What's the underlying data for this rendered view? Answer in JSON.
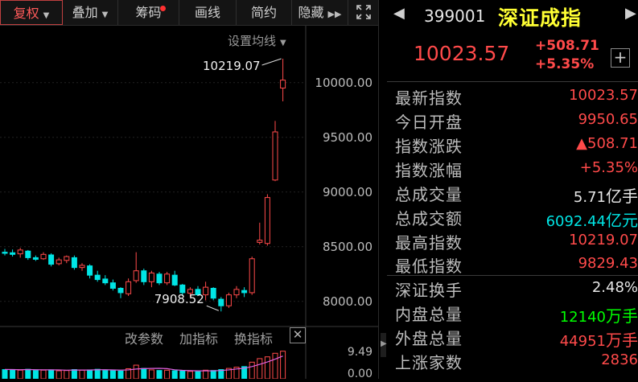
{
  "toolbar": {
    "items": [
      {
        "label": "复权",
        "has_dropdown": true,
        "active": true
      },
      {
        "label": "叠加",
        "has_dropdown": true
      },
      {
        "label": "筹码",
        "has_dot": true
      },
      {
        "label": "画线"
      },
      {
        "label": "简约"
      },
      {
        "label": "隐藏",
        "has_more": true
      }
    ],
    "expand_icon": "fullscreen-icon"
  },
  "chart": {
    "ma_setting_label": "设置均线",
    "price_axis": [
      "10000.00",
      "9500.00",
      "9000.00",
      "8500.00",
      "8000.00"
    ],
    "high_annotation": "10219.07",
    "low_annotation": "7908.52",
    "bottom_links": [
      "改参数",
      "加指标",
      "换指标"
    ],
    "close_icon": "close-icon",
    "volume_axis": [
      "9.49",
      "0.00"
    ],
    "colors": {
      "up": "#ff4a4a",
      "down": "#00e5e5",
      "ma": "#e060e0"
    }
  },
  "chart_data": {
    "type": "candlestick",
    "ylim": [
      7800,
      10300
    ],
    "candles": [
      {
        "o": 8450,
        "h": 8480,
        "l": 8420,
        "c": 8440
      },
      {
        "o": 8445,
        "h": 8475,
        "l": 8410,
        "c": 8430
      },
      {
        "o": 8435,
        "h": 8490,
        "l": 8400,
        "c": 8470
      },
      {
        "o": 8460,
        "h": 8470,
        "l": 8380,
        "c": 8400
      },
      {
        "o": 8400,
        "h": 8420,
        "l": 8370,
        "c": 8385
      },
      {
        "o": 8390,
        "h": 8450,
        "l": 8380,
        "c": 8430
      },
      {
        "o": 8425,
        "h": 8440,
        "l": 8320,
        "c": 8340
      },
      {
        "o": 8345,
        "h": 8400,
        "l": 8330,
        "c": 8380
      },
      {
        "o": 8375,
        "h": 8420,
        "l": 8350,
        "c": 8410
      },
      {
        "o": 8400,
        "h": 8420,
        "l": 8290,
        "c": 8310
      },
      {
        "o": 8310,
        "h": 8350,
        "l": 8280,
        "c": 8330
      },
      {
        "o": 8325,
        "h": 8340,
        "l": 8210,
        "c": 8240
      },
      {
        "o": 8240,
        "h": 8280,
        "l": 8180,
        "c": 8200
      },
      {
        "o": 8205,
        "h": 8240,
        "l": 8150,
        "c": 8170
      },
      {
        "o": 8170,
        "h": 8200,
        "l": 8100,
        "c": 8120
      },
      {
        "o": 8120,
        "h": 8130,
        "l": 8030,
        "c": 8080
      },
      {
        "o": 8070,
        "h": 8210,
        "l": 8050,
        "c": 8180
      },
      {
        "o": 8190,
        "h": 8450,
        "l": 8170,
        "c": 8280
      },
      {
        "o": 8280,
        "h": 8300,
        "l": 8150,
        "c": 8180
      },
      {
        "o": 8180,
        "h": 8280,
        "l": 8130,
        "c": 8260
      },
      {
        "o": 8250,
        "h": 8270,
        "l": 8150,
        "c": 8170
      },
      {
        "o": 8170,
        "h": 8270,
        "l": 8150,
        "c": 8250
      },
      {
        "o": 8240,
        "h": 8280,
        "l": 8140,
        "c": 8150
      },
      {
        "o": 8150,
        "h": 8160,
        "l": 8050,
        "c": 8080
      },
      {
        "o": 8075,
        "h": 8130,
        "l": 8040,
        "c": 8110
      },
      {
        "o": 8110,
        "h": 8140,
        "l": 8050,
        "c": 8060
      },
      {
        "o": 8060,
        "h": 8180,
        "l": 8010,
        "c": 8130
      },
      {
        "o": 8120,
        "h": 8130,
        "l": 8010,
        "c": 8030
      },
      {
        "o": 8020,
        "h": 8040,
        "l": 7908.52,
        "c": 7960
      },
      {
        "o": 7960,
        "h": 8080,
        "l": 7940,
        "c": 8060
      },
      {
        "o": 8060,
        "h": 8140,
        "l": 8030,
        "c": 8110
      },
      {
        "o": 8100,
        "h": 8130,
        "l": 8040,
        "c": 8080
      },
      {
        "o": 8080,
        "h": 8410,
        "l": 8060,
        "c": 8390
      },
      {
        "o": 8540,
        "h": 8720,
        "l": 8520,
        "c": 8560
      },
      {
        "o": 8530,
        "h": 8980,
        "l": 8510,
        "c": 8950
      },
      {
        "o": 9110,
        "h": 9650,
        "l": 9100,
        "c": 9550
      },
      {
        "o": 9950.65,
        "h": 10219.07,
        "l": 9829.43,
        "c": 10023.57
      }
    ],
    "volume_ylim": [
      0,
      9.49
    ],
    "volumes": [
      3.1,
      3.0,
      2.9,
      3.2,
      2.8,
      2.9,
      3.0,
      2.7,
      2.8,
      3.1,
      2.9,
      3.0,
      3.2,
      2.8,
      2.7,
      2.6,
      3.4,
      4.6,
      3.5,
      3.0,
      2.8,
      2.9,
      2.7,
      2.6,
      2.5,
      2.4,
      2.9,
      2.8,
      3.1,
      3.5,
      3.9,
      4.1,
      5.6,
      6.8,
      7.4,
      8.6,
      9.3
    ]
  },
  "quote": {
    "code": "399001",
    "name": "深证成指",
    "price": "10023.57",
    "change": "+508.71",
    "change_pct": "+5.35%",
    "add_icon": "add-icon",
    "nav_prev_icon": "chevron-left-icon",
    "nav_next_icon": "chevron-right-icon",
    "colors": {
      "up": "#ff4a4a",
      "white": "#e6e6e6",
      "cyan": "#00e5e5",
      "green": "#00ff00",
      "name": "#ffff33"
    },
    "stats": [
      {
        "label": "最新指数",
        "value": "10023.57",
        "color": "up"
      },
      {
        "label": "今日开盘",
        "value": "9950.65",
        "color": "up"
      },
      {
        "label": "指数涨跌",
        "value": "▲508.71",
        "color": "up"
      },
      {
        "label": "指数涨幅",
        "value": "+5.35%",
        "color": "up"
      },
      {
        "label": "总成交量",
        "value": "5.71",
        "unit": "亿手",
        "color": "white"
      },
      {
        "label": "总成交额",
        "value": "6092.44",
        "unit": "亿元",
        "color": "cyan"
      },
      {
        "label": "最高指数",
        "value": "10219.07",
        "color": "up"
      },
      {
        "label": "最低指数",
        "value": "9829.43",
        "color": "up"
      },
      {
        "label": "深证换手",
        "value": "2.48%",
        "color": "white"
      },
      {
        "label": "内盘总量",
        "value": "12140",
        "unit": "万手",
        "color": "green"
      },
      {
        "label": "外盘总量",
        "value": "44951",
        "unit": "万手",
        "color": "up"
      },
      {
        "label": "上涨家数",
        "value": "2836",
        "color": "up"
      }
    ]
  }
}
